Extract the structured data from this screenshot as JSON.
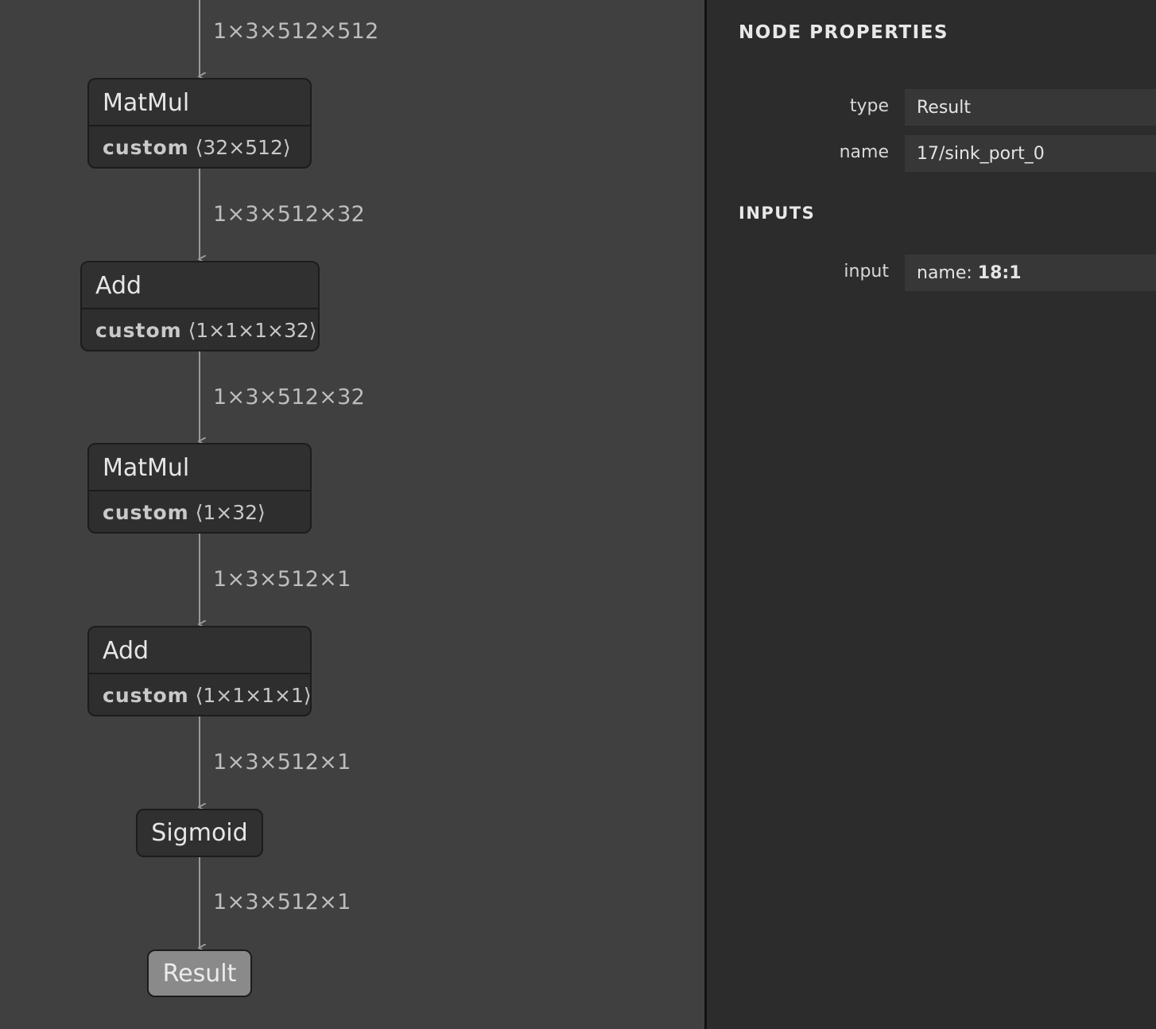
{
  "graph": {
    "edges": [
      {
        "label": "1×3×512×512"
      },
      {
        "label": "1×3×512×32"
      },
      {
        "label": "1×3×512×32"
      },
      {
        "label": "1×3×512×1"
      },
      {
        "label": "1×3×512×1"
      },
      {
        "label": "1×3×512×1"
      }
    ],
    "nodes": [
      {
        "op": "MatMul",
        "attr_name": "custom",
        "attr_shape": "⟨32×512⟩"
      },
      {
        "op": "Add",
        "attr_name": "custom",
        "attr_shape": "⟨1×1×1×32⟩"
      },
      {
        "op": "MatMul",
        "attr_name": "custom",
        "attr_shape": "⟨1×32⟩"
      },
      {
        "op": "Add",
        "attr_name": "custom",
        "attr_shape": "⟨1×1×1×1⟩"
      },
      {
        "op": "Sigmoid"
      },
      {
        "op": "Result"
      }
    ]
  },
  "sidebar": {
    "node_properties_title": "NODE PROPERTIES",
    "properties": [
      {
        "label": "type",
        "value": "Result"
      },
      {
        "label": "name",
        "value": "17/sink_port_0"
      }
    ],
    "inputs_title": "INPUTS",
    "inputs": [
      {
        "label": "input",
        "value_prefix": "name: ",
        "value_bold": "18:1"
      }
    ]
  },
  "colors": {
    "canvas": "#404040",
    "node_fill": "#2e2e2e",
    "selected_node_fill": "#8a8a8a",
    "sidebar": "#2c2c2c",
    "edge": "#9a9a9a"
  }
}
